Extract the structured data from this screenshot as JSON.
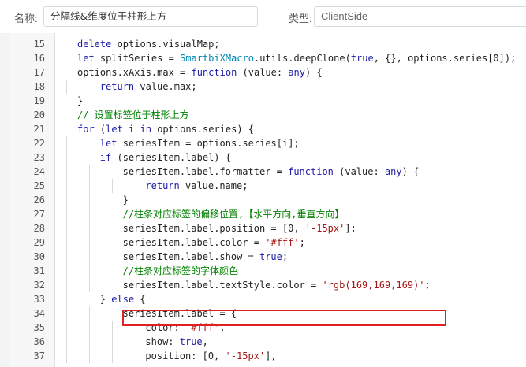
{
  "header": {
    "name_label": "名称:",
    "name_value": "分隔线&维度位于柱形上方",
    "type_label": "类型:",
    "type_value": "ClientSide"
  },
  "editor": {
    "lines": [
      {
        "num": "15",
        "indent": 0,
        "tokens": [
          {
            "t": "kw",
            "v": "delete"
          },
          {
            "t": "plain",
            "v": " options.visualMap;"
          }
        ]
      },
      {
        "num": "16",
        "indent": 0,
        "tokens": [
          {
            "t": "kw",
            "v": "let"
          },
          {
            "t": "plain",
            "v": " splitSeries = "
          },
          {
            "t": "cls",
            "v": "SmartbiXMacro"
          },
          {
            "t": "plain",
            "v": ".utils.deepClone("
          },
          {
            "t": "kw",
            "v": "true"
          },
          {
            "t": "plain",
            "v": ", {}, options.series[0]);"
          }
        ]
      },
      {
        "num": "17",
        "indent": 0,
        "tokens": [
          {
            "t": "plain",
            "v": "options.xAxis.max = "
          },
          {
            "t": "kw",
            "v": "function"
          },
          {
            "t": "plain",
            "v": " (value: "
          },
          {
            "t": "kw",
            "v": "any"
          },
          {
            "t": "plain",
            "v": ") {"
          }
        ]
      },
      {
        "num": "18",
        "indent": 1,
        "tokens": [
          {
            "t": "kw",
            "v": "return"
          },
          {
            "t": "plain",
            "v": " value.max;"
          }
        ]
      },
      {
        "num": "19",
        "indent": 0,
        "tokens": [
          {
            "t": "plain",
            "v": "}"
          }
        ]
      },
      {
        "num": "20",
        "indent": 0,
        "tokens": [
          {
            "t": "cmt",
            "v": "// 设置标签位于柱形上方"
          }
        ]
      },
      {
        "num": "21",
        "indent": 0,
        "tokens": [
          {
            "t": "kw",
            "v": "for"
          },
          {
            "t": "plain",
            "v": " ("
          },
          {
            "t": "kw",
            "v": "let"
          },
          {
            "t": "plain",
            "v": " i "
          },
          {
            "t": "kw",
            "v": "in"
          },
          {
            "t": "plain",
            "v": " options.series) {"
          }
        ]
      },
      {
        "num": "22",
        "indent": 1,
        "tokens": [
          {
            "t": "kw",
            "v": "let"
          },
          {
            "t": "plain",
            "v": " seriesItem = options.series[i];"
          }
        ]
      },
      {
        "num": "23",
        "indent": 1,
        "tokens": [
          {
            "t": "kw",
            "v": "if"
          },
          {
            "t": "plain",
            "v": " (seriesItem.label) {"
          }
        ]
      },
      {
        "num": "24",
        "indent": 2,
        "tokens": [
          {
            "t": "plain",
            "v": "seriesItem.label.formatter = "
          },
          {
            "t": "kw",
            "v": "function"
          },
          {
            "t": "plain",
            "v": " (value: "
          },
          {
            "t": "kw",
            "v": "any"
          },
          {
            "t": "plain",
            "v": ") {"
          }
        ]
      },
      {
        "num": "25",
        "indent": 3,
        "tokens": [
          {
            "t": "kw",
            "v": "return"
          },
          {
            "t": "plain",
            "v": " value.name;"
          }
        ]
      },
      {
        "num": "26",
        "indent": 2,
        "tokens": [
          {
            "t": "plain",
            "v": "}"
          }
        ]
      },
      {
        "num": "27",
        "indent": 2,
        "tokens": [
          {
            "t": "cmt",
            "v": "//柱条对应标签的偏移位置,【水平方向,垂直方向】"
          }
        ]
      },
      {
        "num": "28",
        "indent": 2,
        "tokens": [
          {
            "t": "plain",
            "v": "seriesItem.label.position = [0, "
          },
          {
            "t": "str",
            "v": "'-15px'"
          },
          {
            "t": "plain",
            "v": "];"
          }
        ]
      },
      {
        "num": "29",
        "indent": 2,
        "tokens": [
          {
            "t": "plain",
            "v": "seriesItem.label.color = "
          },
          {
            "t": "str",
            "v": "'#fff'"
          },
          {
            "t": "plain",
            "v": ";"
          }
        ]
      },
      {
        "num": "30",
        "indent": 2,
        "tokens": [
          {
            "t": "plain",
            "v": "seriesItem.label.show = "
          },
          {
            "t": "kw",
            "v": "true"
          },
          {
            "t": "plain",
            "v": ";"
          }
        ]
      },
      {
        "num": "31",
        "indent": 2,
        "tokens": [
          {
            "t": "cmt",
            "v": "//柱条对应标签的字体颜色"
          }
        ]
      },
      {
        "num": "32",
        "indent": 2,
        "tokens": [
          {
            "t": "plain",
            "v": "seriesItem.label.textStyle.color = "
          },
          {
            "t": "str",
            "v": "'rgb(169,169,169)'"
          },
          {
            "t": "plain",
            "v": ";"
          }
        ]
      },
      {
        "num": "33",
        "indent": 1,
        "tokens": [
          {
            "t": "plain",
            "v": "} "
          },
          {
            "t": "kw",
            "v": "else"
          },
          {
            "t": "plain",
            "v": " {"
          }
        ]
      },
      {
        "num": "34",
        "indent": 2,
        "tokens": [
          {
            "t": "plain",
            "v": "seriesItem.label = {"
          }
        ]
      },
      {
        "num": "35",
        "indent": 3,
        "tokens": [
          {
            "t": "plain",
            "v": "color: "
          },
          {
            "t": "str",
            "v": "'#fff'"
          },
          {
            "t": "plain",
            "v": ","
          }
        ]
      },
      {
        "num": "36",
        "indent": 3,
        "tokens": [
          {
            "t": "plain",
            "v": "show: "
          },
          {
            "t": "kw",
            "v": "true"
          },
          {
            "t": "plain",
            "v": ","
          }
        ]
      },
      {
        "num": "37",
        "indent": 3,
        "tokens": [
          {
            "t": "plain",
            "v": "position: [0, "
          },
          {
            "t": "str",
            "v": "'-15px'"
          },
          {
            "t": "plain",
            "v": "],"
          }
        ]
      }
    ],
    "highlighted_line": "32"
  },
  "colors": {
    "keyword": "#1a1aa6",
    "string": "#a31515",
    "comment": "#008000",
    "class": "#0086b3",
    "highlight_border": "#e02020"
  }
}
